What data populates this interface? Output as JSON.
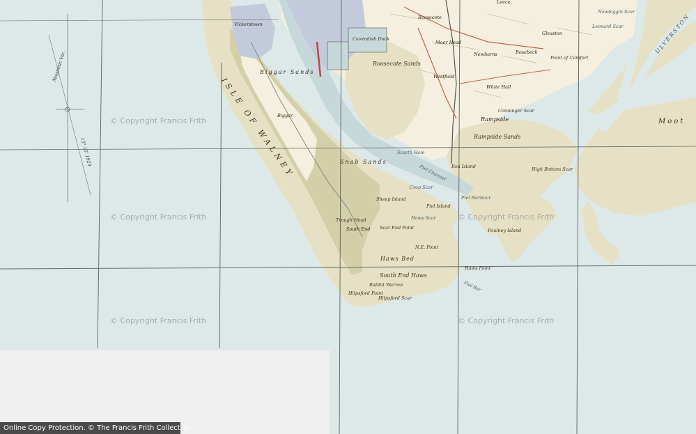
{
  "map": {
    "colors": {
      "sea": "#dde8e8",
      "sand": "#e6e1c4",
      "sand_dark": "#d3cfa8",
      "land": "#f4efde",
      "town": "#c3cadb",
      "rail": "#c0473c",
      "grid": "#6a6a6a",
      "channel": "#c6d8da"
    },
    "labels": [
      {
        "name": "place-vickerstown",
        "text": "Vickerstown",
        "size": "small"
      },
      {
        "name": "place-cavendish-dock",
        "text": "Cavendish Dock",
        "size": "small"
      },
      {
        "name": "place-roosecote-top",
        "text": "Roosecote",
        "size": "small"
      },
      {
        "name": "place-leece",
        "text": "Leece",
        "size": "small"
      },
      {
        "name": "place-newbiggin-scar",
        "text": "Newbiggin Scar",
        "size": "small"
      },
      {
        "name": "place-leonard-scar",
        "text": "Leonard Scar",
        "size": "small"
      },
      {
        "name": "place-gleaston",
        "text": "Gleaston",
        "size": "small"
      },
      {
        "name": "place-rosebeck",
        "text": "Rosebeck",
        "size": "small"
      },
      {
        "name": "place-point-of-comfort",
        "text": "Point of Comfort",
        "size": "small"
      },
      {
        "name": "place-moorhead",
        "text": "Moor Head",
        "size": "small"
      },
      {
        "name": "place-westfield",
        "text": "Westfield",
        "size": "small"
      },
      {
        "name": "place-newbarns",
        "text": "Newbarns",
        "size": "small"
      },
      {
        "name": "place-roosecote-sands",
        "text": "Roosecote Sands",
        "size": "medium"
      },
      {
        "name": "place-rampside",
        "text": "Rampside",
        "size": "medium"
      },
      {
        "name": "place-rampside-sands",
        "text": "Rampside Sands",
        "size": "medium"
      },
      {
        "name": "place-white-hall",
        "text": "White Hall",
        "size": "small"
      },
      {
        "name": "place-conniscar",
        "text": "Conninger Scar",
        "size": "small"
      },
      {
        "name": "place-foulney",
        "text": "Foulney Island",
        "size": "small"
      },
      {
        "name": "place-high-bottom",
        "text": "High Bottom Scar",
        "size": "small"
      },
      {
        "name": "place-roa-island",
        "text": "Roa Island",
        "size": "small"
      },
      {
        "name": "place-piel-channel",
        "text": "Piel Channel",
        "size": "small"
      },
      {
        "name": "place-piel-island",
        "text": "Piel Island",
        "size": "small"
      },
      {
        "name": "place-piel-harbour",
        "text": "Piel Harbour",
        "size": "small"
      },
      {
        "name": "place-scarth",
        "text": "Scarth Hole",
        "size": "small"
      },
      {
        "name": "place-snab-sands",
        "text": "Snab Sands",
        "size": "medium"
      },
      {
        "name": "place-biggar-sands",
        "text": "Biggar Sands",
        "size": "medium"
      },
      {
        "name": "place-biggar",
        "text": "Biggar",
        "size": "small"
      },
      {
        "name": "place-isle-of-walney",
        "text": "ISLE OF WALNEY",
        "size": "xlarge"
      },
      {
        "name": "place-sheep-island",
        "text": "Sheep Island",
        "size": "small"
      },
      {
        "name": "place-trough-head",
        "text": "Trough Head",
        "size": "small"
      },
      {
        "name": "place-south-end",
        "text": "South End",
        "size": "small"
      },
      {
        "name": "place-haws-bed",
        "text": "Haws Bed",
        "size": "medium"
      },
      {
        "name": "place-south-end-haws",
        "text": "South End Haws",
        "size": "medium"
      },
      {
        "name": "place-rabbit-warren",
        "text": "Rabbit Warren",
        "size": "small"
      },
      {
        "name": "place-hilpsford-point",
        "text": "Hilpsford Point",
        "size": "small"
      },
      {
        "name": "place-hilpsford-scar",
        "text": "Hilpsford Scar",
        "size": "small"
      },
      {
        "name": "place-ne-point",
        "text": "N.E. Point",
        "size": "small"
      },
      {
        "name": "place-haws-point",
        "text": "Haws Point",
        "size": "small"
      },
      {
        "name": "place-piel-bar",
        "text": "Piel Bar",
        "size": "small"
      },
      {
        "name": "place-ulverston",
        "text": "ULVERSTON",
        "size": "medium"
      },
      {
        "name": "place-moot",
        "text": "Moot",
        "size": "large"
      },
      {
        "name": "place-crop-scar",
        "text": "Crop Scar",
        "size": "small"
      },
      {
        "name": "place-hare-scar",
        "text": "Haws Scar",
        "size": "small"
      },
      {
        "name": "place-scar-end-point",
        "text": "Scar End Point",
        "size": "small"
      },
      {
        "name": "place-magnetic-var",
        "text": "Magnetic Var.",
        "size": "small"
      },
      {
        "name": "place-year",
        "text": "15° 15' 1923",
        "size": "small"
      }
    ],
    "watermark_text": "© Copyright Francis Frith"
  },
  "footer": {
    "text": "Online Copy Protection.  © The Francis Frith Collection"
  }
}
